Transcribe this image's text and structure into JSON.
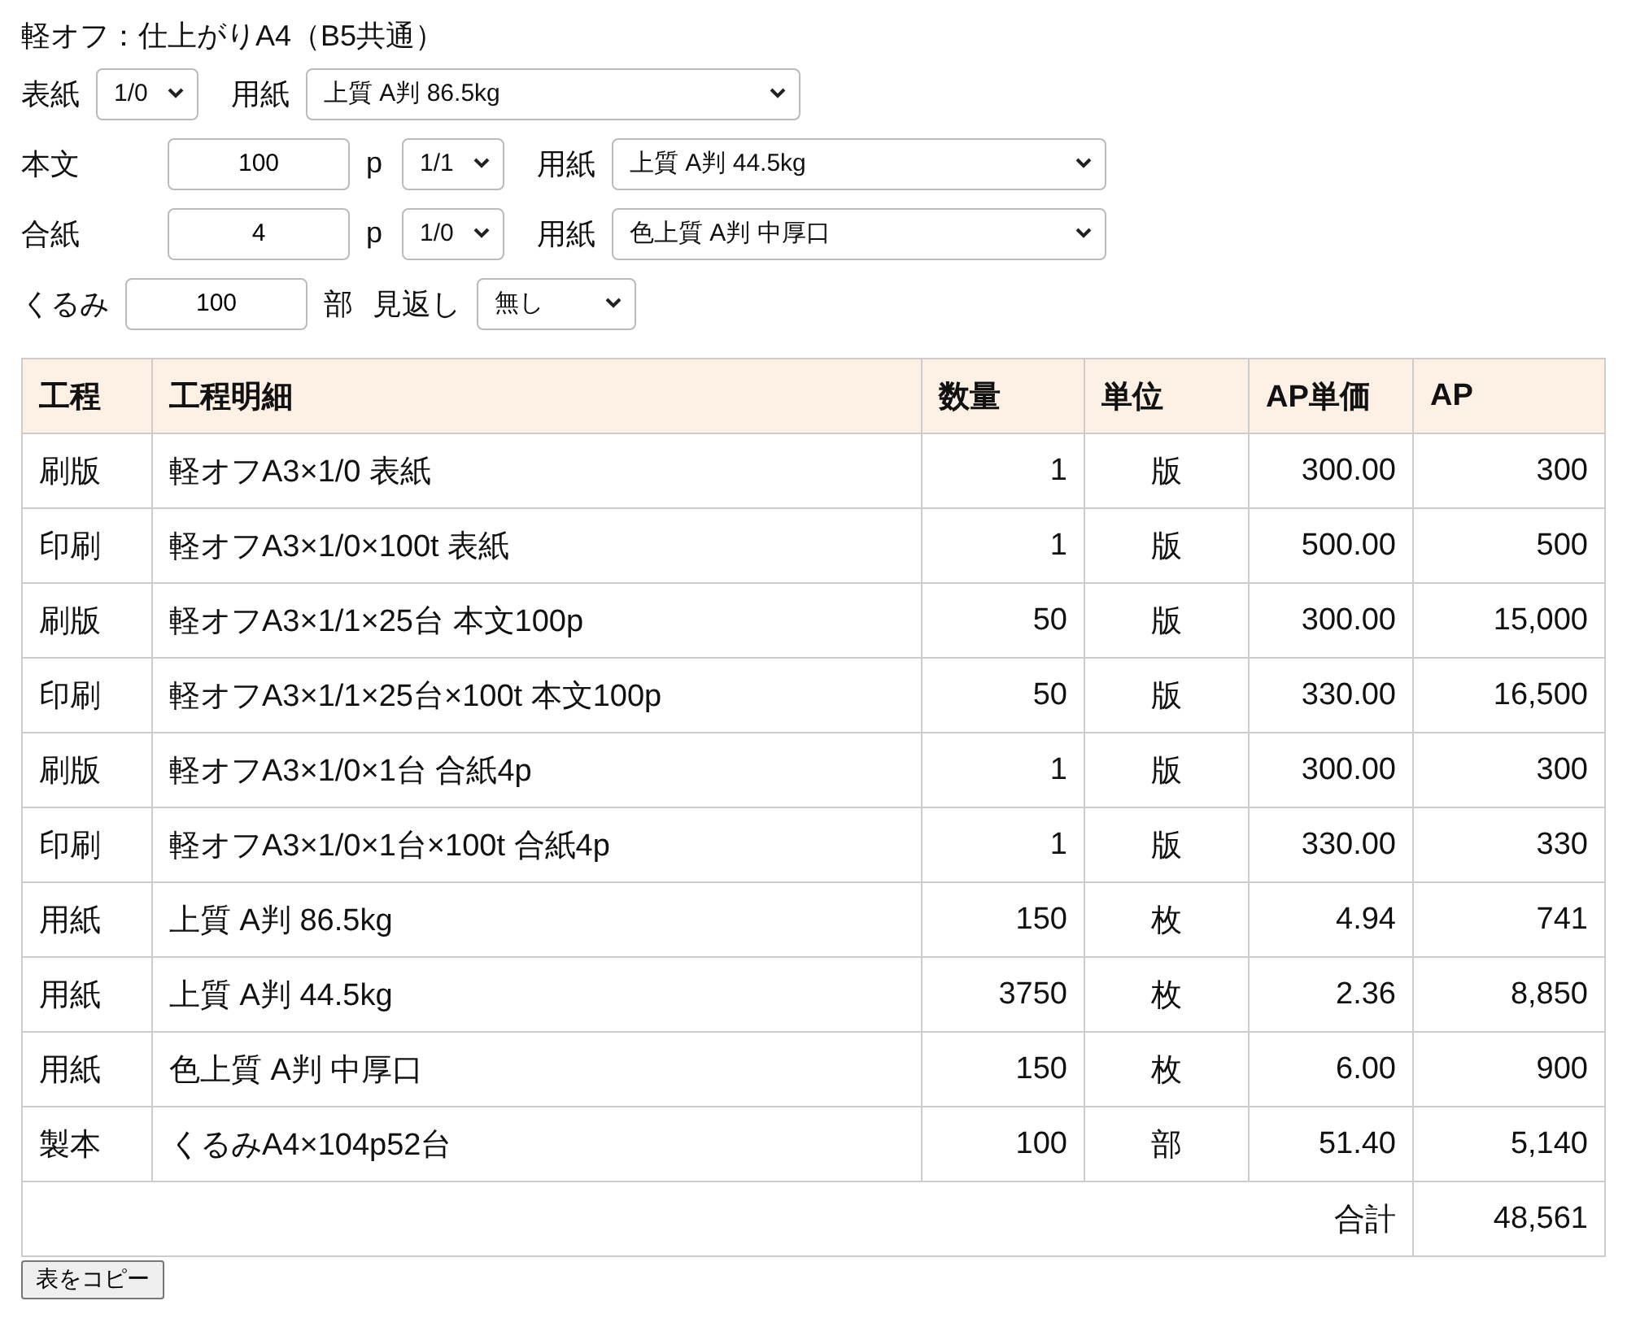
{
  "title": "軽オフ：仕上がりA4（B5共通）",
  "cover": {
    "label": "表紙",
    "colors": "1/0",
    "paper_label": "用紙",
    "paper": "上質 A判 86.5kg"
  },
  "sections": [
    {
      "label": "本文",
      "pages": "100",
      "unit": "p",
      "colors": "1/1",
      "paper_label": "用紙",
      "paper": "上質 A判 44.5kg"
    },
    {
      "label": "合紙",
      "pages": "4",
      "unit": "p",
      "colors": "1/0",
      "paper_label": "用紙",
      "paper": "色上質 A判 中厚口"
    }
  ],
  "binding": {
    "label": "くるみ",
    "copies": "100",
    "unit": "部",
    "endpaper_label": "見返し",
    "endpaper": "無し"
  },
  "table": {
    "columns": [
      "工程",
      "工程明細",
      "数量",
      "単位",
      "AP単価",
      "AP"
    ],
    "rows": [
      [
        "刷版",
        "軽オフA3×1/0 表紙",
        "1",
        "版",
        "300.00",
        "300"
      ],
      [
        "印刷",
        "軽オフA3×1/0×100t 表紙",
        "1",
        "版",
        "500.00",
        "500"
      ],
      [
        "刷版",
        "軽オフA3×1/1×25台 本文100p",
        "50",
        "版",
        "300.00",
        "15,000"
      ],
      [
        "印刷",
        "軽オフA3×1/1×25台×100t 本文100p",
        "50",
        "版",
        "330.00",
        "16,500"
      ],
      [
        "刷版",
        "軽オフA3×1/0×1台 合紙4p",
        "1",
        "版",
        "300.00",
        "300"
      ],
      [
        "印刷",
        "軽オフA3×1/0×1台×100t 合紙4p",
        "1",
        "版",
        "330.00",
        "330"
      ],
      [
        "用紙",
        "上質 A判 86.5kg",
        "150",
        "枚",
        "4.94",
        "741"
      ],
      [
        "用紙",
        "上質 A判 44.5kg",
        "3750",
        "枚",
        "2.36",
        "8,850"
      ],
      [
        "用紙",
        "色上質 A判 中厚口",
        "150",
        "枚",
        "6.00",
        "900"
      ],
      [
        "製本",
        "くるみA4×104p52台",
        "100",
        "部",
        "51.40",
        "5,140"
      ]
    ],
    "total": {
      "label": "合計",
      "value": "48,561"
    }
  },
  "copy_button": "表をコピー"
}
